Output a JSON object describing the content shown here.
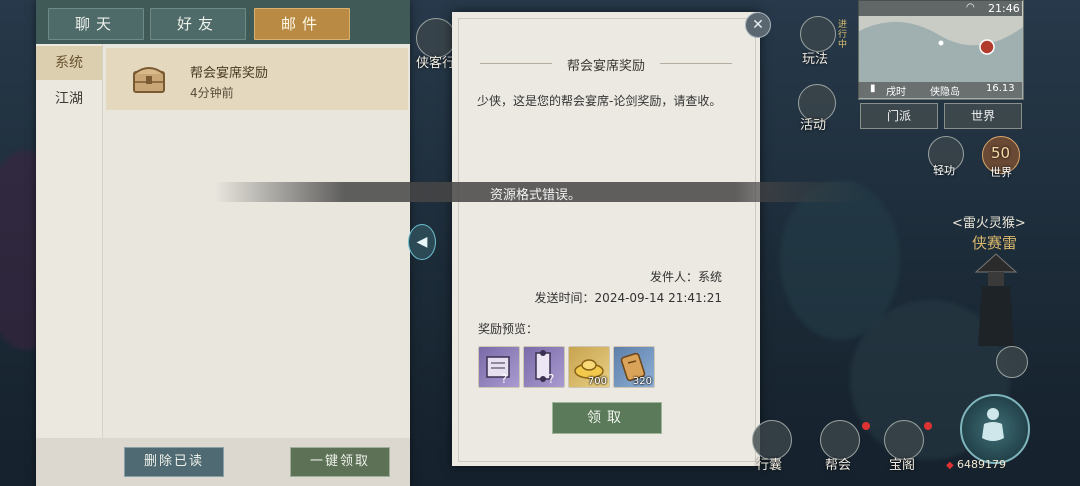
{
  "tabs": [
    {
      "label": "聊天",
      "active": false
    },
    {
      "label": "好友",
      "active": false
    },
    {
      "label": "邮件",
      "active": true
    }
  ],
  "categories": [
    {
      "label": "系统",
      "active": true
    },
    {
      "label": "江湖",
      "active": false
    }
  ],
  "mail_list": [
    {
      "title": "帮会宴席奖励",
      "time": "4分钟前",
      "icon": "treasure-chest-icon"
    }
  ],
  "footer_buttons": {
    "delete": "删除已读",
    "claim_all": "一键领取"
  },
  "letter": {
    "title": "帮会宴席奖励",
    "body": "少侠，这是您的帮会宴席-论剑奖励，请查收。",
    "sender": "发件人：系统",
    "send_time": "发送时间：2024-09-14 21:41:21",
    "preview_label": "奖励预览：",
    "rewards": [
      {
        "icon": "book-icon",
        "count": ""
      },
      {
        "icon": "scroll-icon",
        "count": ""
      },
      {
        "icon": "gold-ingot-icon",
        "count": "700"
      },
      {
        "icon": "token-scroll-icon",
        "count": "320"
      }
    ],
    "claim_button": "领取"
  },
  "toast": "资源格式错误。",
  "hud": {
    "clock": "21:46",
    "map_period": "戌时",
    "map_place": "侠隐岛",
    "map_coord": "16.13",
    "faction_button": "门派",
    "world_button": "世界",
    "wanfa_label": "玩法",
    "wanfa_badge": "进行中",
    "huodong_label": "活动",
    "qinggong_label": "轻功",
    "world_level": "50",
    "world_level_label": "世界",
    "boss_name": "<雷火灵猴>",
    "boss_sub": "侠赛雷",
    "xianghuo_label": "侠客行",
    "bottom_items": [
      "行囊",
      "帮会",
      "宝阁"
    ],
    "currency": "6489179"
  }
}
